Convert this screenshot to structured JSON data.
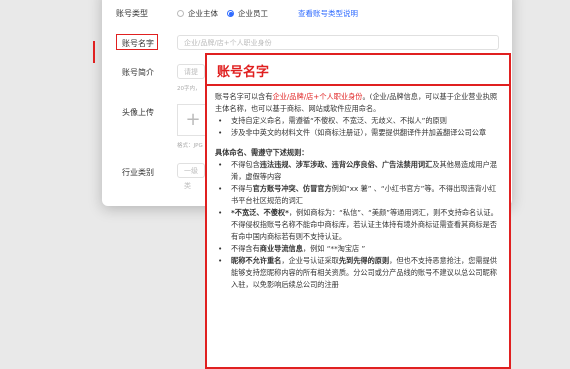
{
  "form": {
    "account_type_label": "账号类型",
    "account_type_options": [
      "企业主体",
      "企业员工"
    ],
    "account_type_selected": "企业员工",
    "account_type_help_link": "查看账号类型说明",
    "account_name_label": "账号名字",
    "account_name_placeholder": "企业/品牌/店+个人职业身份",
    "account_intro_label": "账号简介",
    "account_intro_placeholder": "请提",
    "account_intro_hint": "20字内，",
    "avatar_label": "头像上传",
    "avatar_plus": "+",
    "avatar_hint": "格式：JPG",
    "industry_label": "行业类别",
    "industry_placeholder": "一级类"
  },
  "tooltip": {
    "title": "账号名字",
    "intro_prefix": "账号名字可以含有",
    "intro_highlight": "企业/品牌/店+个人职业身份",
    "intro_suffix": "。(企业/品牌信息，可以基于企业营业执照主体名称，也可以基于商标、网站或软件应用命名。",
    "bullets_top": [
      "支持自定义命名，需遵循“不傻权、不宽泛、无歧义、不拟人”的原则",
      "涉及非中英文的材料文件（如商标注册证），需要提供翻译件并加盖翻译公司公章"
    ],
    "rules_title": "具体命名、需遵守下述规则：",
    "rule1_a": "不得包含",
    "rule1_b": "违法违规、涉军涉政、违背公序良俗、广告法禁用词汇",
    "rule1_c": "及其他易造成用户混淆，虚假等内容",
    "rule2_a": "不得与",
    "rule2_b": "官方账号冲突、仿冒官方",
    "rule2_c": "例如“xx 薯” 、“小红书官方”等。不得出现违背小红书平台社区规范的词汇",
    "rule3_a": "*不宽泛、不傻权*",
    "rule3_b": "，例如商标为：“私信”、“美颜”等通用词汇，则不支持命名认证。不得侵权指账号名称不能命中商标库，若认证主体持有境外商标证需查看其商标是否有命中国内商标若有则不支持认证。",
    "rule4_a": "不得含有",
    "rule4_b": "商业导流信息",
    "rule4_c": "，例如 “**淘宝店 ”",
    "rule5_a": "昵称不允许重名",
    "rule5_b": "，企业号认证采取",
    "rule5_c": "先到先得的原则",
    "rule5_d": "，但也不支持恶意抢注，您需提供能够支持您昵称内容的所有相关资质。分公司或分产品线的账号不建议以总公司昵称入驻，以免影响后续总公司的注册"
  }
}
